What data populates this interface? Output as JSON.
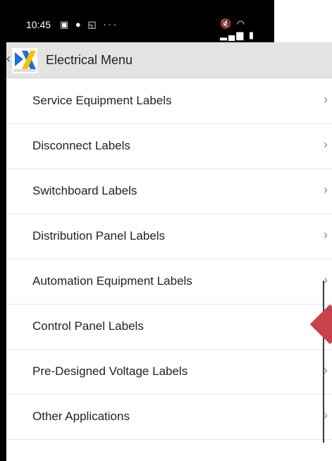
{
  "status_bar": {
    "time": "10:45",
    "left_icons": "▣ ● ◱ ···",
    "right_icons": "🔇 ◠ ▂▄▆ ▮"
  },
  "app_bar": {
    "title": "Electrical Menu",
    "logo": "dx-electrical-logo",
    "back_icon": "chevron-left-icon"
  },
  "menu": {
    "items": [
      {
        "label": "Service Equipment Labels"
      },
      {
        "label": "Disconnect Labels"
      },
      {
        "label": "Switchboard Labels"
      },
      {
        "label": "Distribution Panel Labels"
      },
      {
        "label": "Automation Equipment Labels"
      },
      {
        "label": "Control Panel Labels"
      },
      {
        "label": "Pre-Designed Voltage Labels"
      },
      {
        "label": "Other Applications"
      }
    ],
    "chevron": "›"
  },
  "colors": {
    "app_bar_bg": "#e3e3e3",
    "status_bar_bg": "#000000",
    "logo_blue": "#1f6fd1",
    "logo_yellow": "#f2c200",
    "marker_red": "#c8424a"
  }
}
